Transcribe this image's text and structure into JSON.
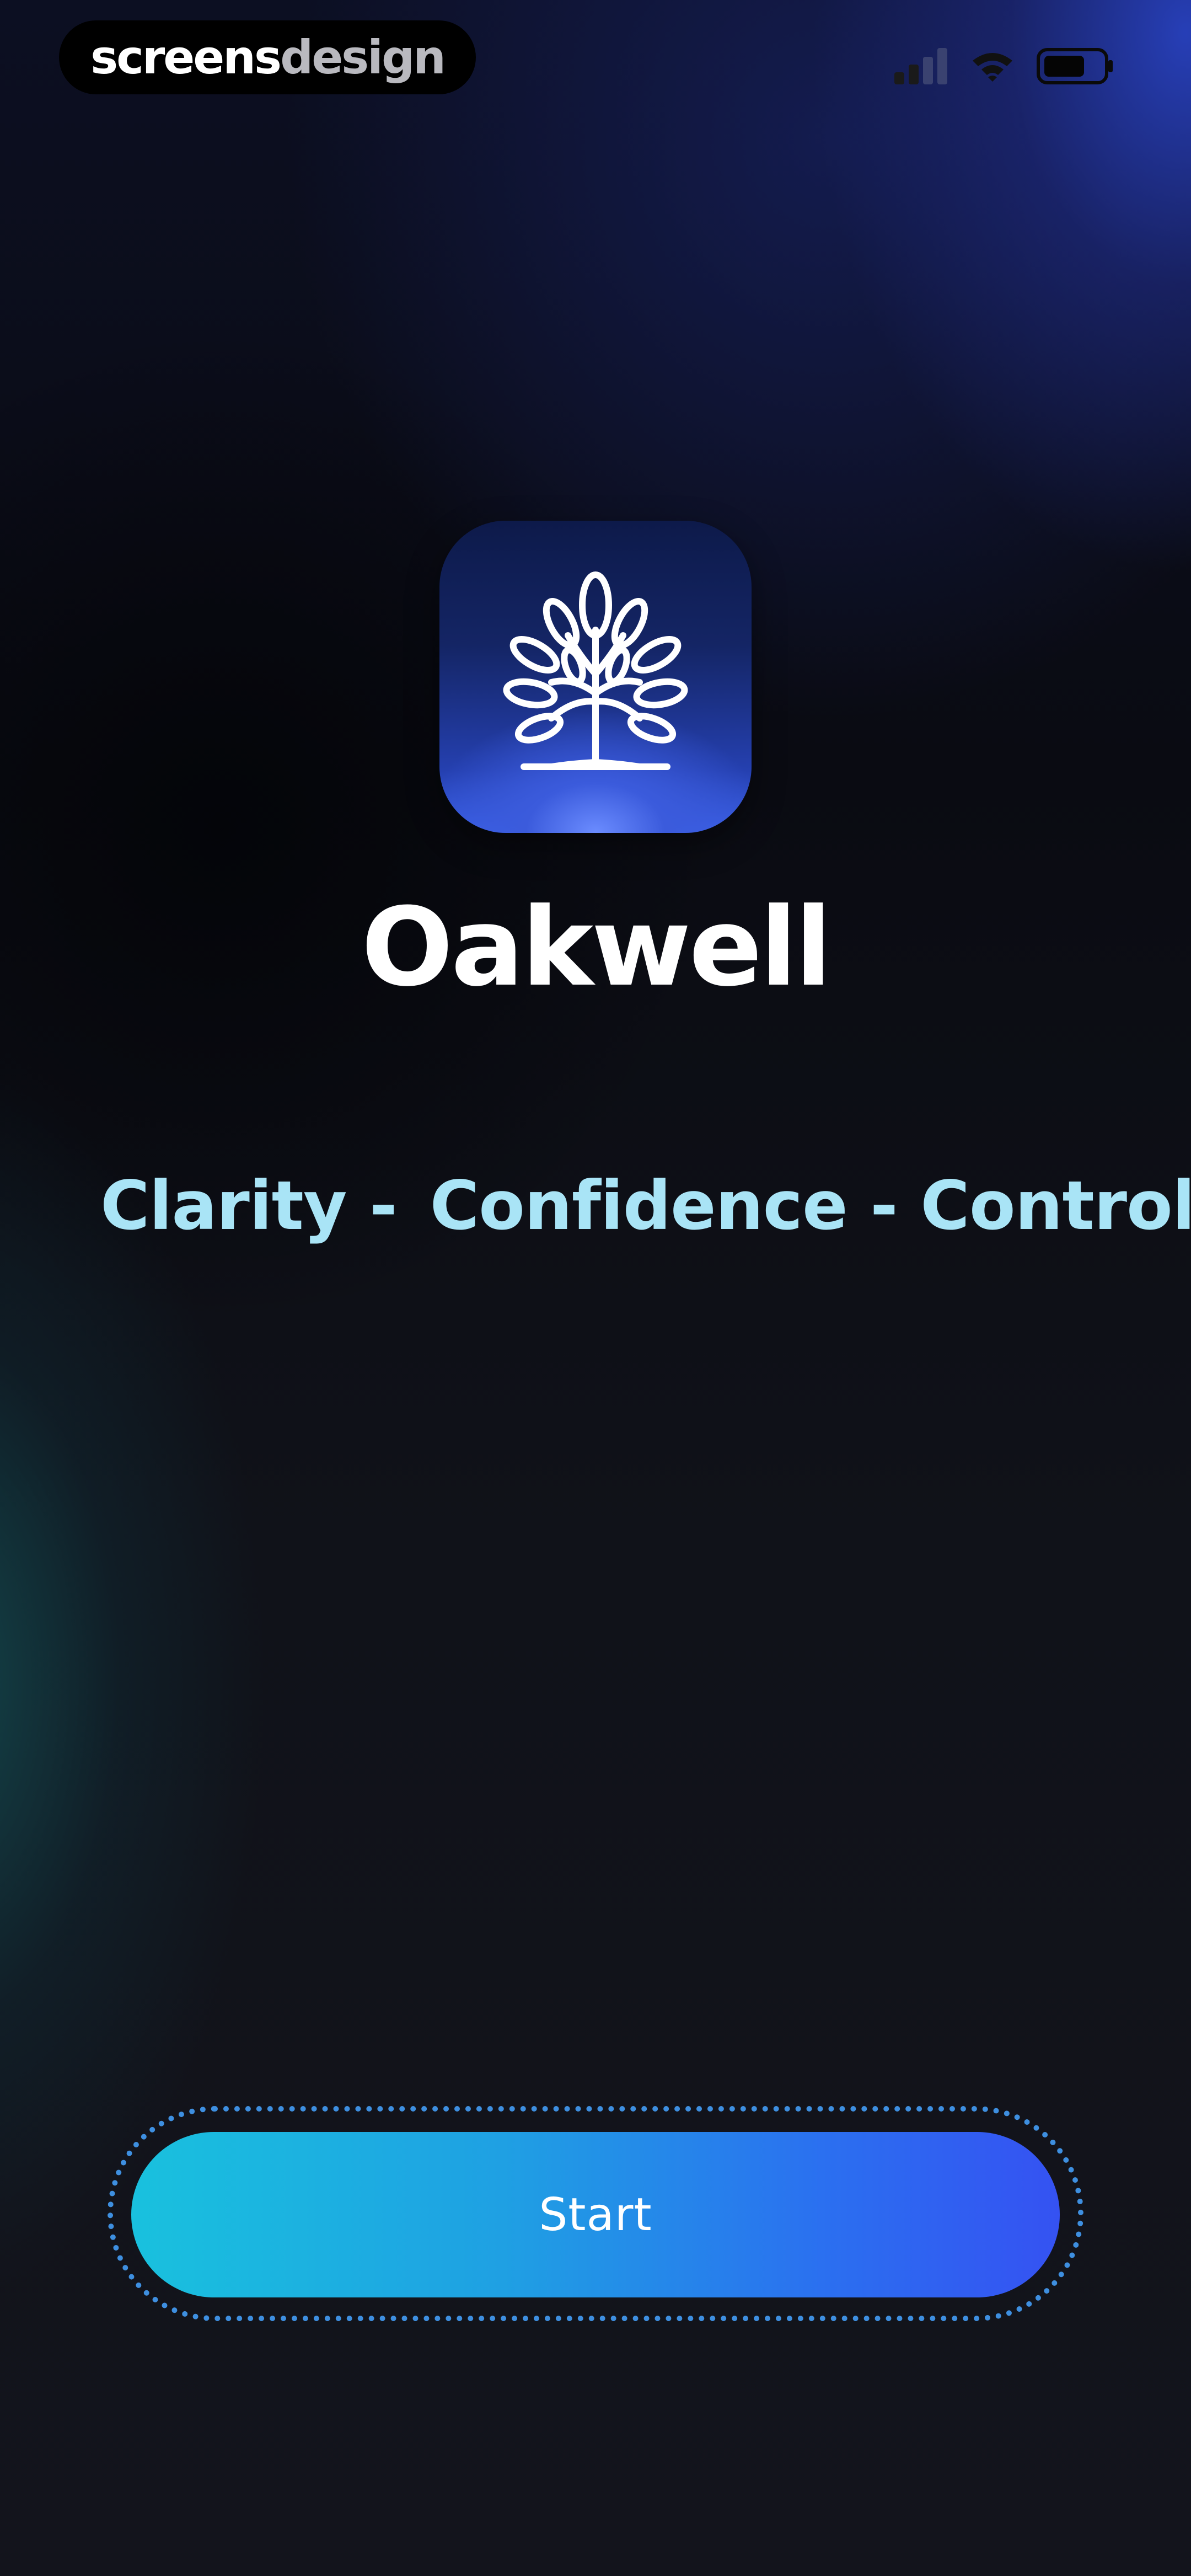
{
  "status_bar": {
    "brand_part1": "screens",
    "brand_part2": "design",
    "icons": [
      "cellular-signal-icon",
      "wifi-icon",
      "battery-icon"
    ]
  },
  "app": {
    "icon": "oak-tree-icon",
    "name": "Oakwell",
    "tagline": [
      "Clarity -",
      "Confidence - Control"
    ]
  },
  "actions": {
    "start_label": "Start"
  },
  "colors": {
    "background": "#12131c",
    "tagline": "#a9e4f6",
    "button_gradient_start": "#19c1de",
    "button_gradient_end": "#3552f2",
    "button_ring": "#3e8fe0"
  }
}
